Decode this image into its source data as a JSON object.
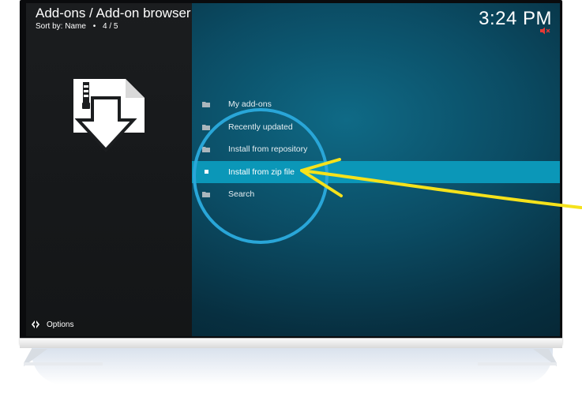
{
  "header": {
    "title": "Add-ons / Add-on browser",
    "sort_label": "Sort by: Name",
    "separator": "•",
    "position": "4 / 5"
  },
  "clock": {
    "time": "3:24 PM"
  },
  "menu": {
    "items": [
      {
        "label": "My add-ons",
        "icon": "folder-icon"
      },
      {
        "label": "Recently updated",
        "icon": "folder-icon"
      },
      {
        "label": "Install from repository",
        "icon": "folder-icon"
      },
      {
        "label": "Install from zip file",
        "icon": "square-bullet-icon",
        "selected": true
      },
      {
        "label": "Search",
        "icon": "folder-icon"
      }
    ]
  },
  "footer": {
    "options_label": "Options"
  },
  "colors": {
    "selection": "#0b97b8",
    "annotation_arrow": "#f5e21b",
    "annotation_circle": "#29a6d8",
    "mute_indicator": "#e53935"
  }
}
